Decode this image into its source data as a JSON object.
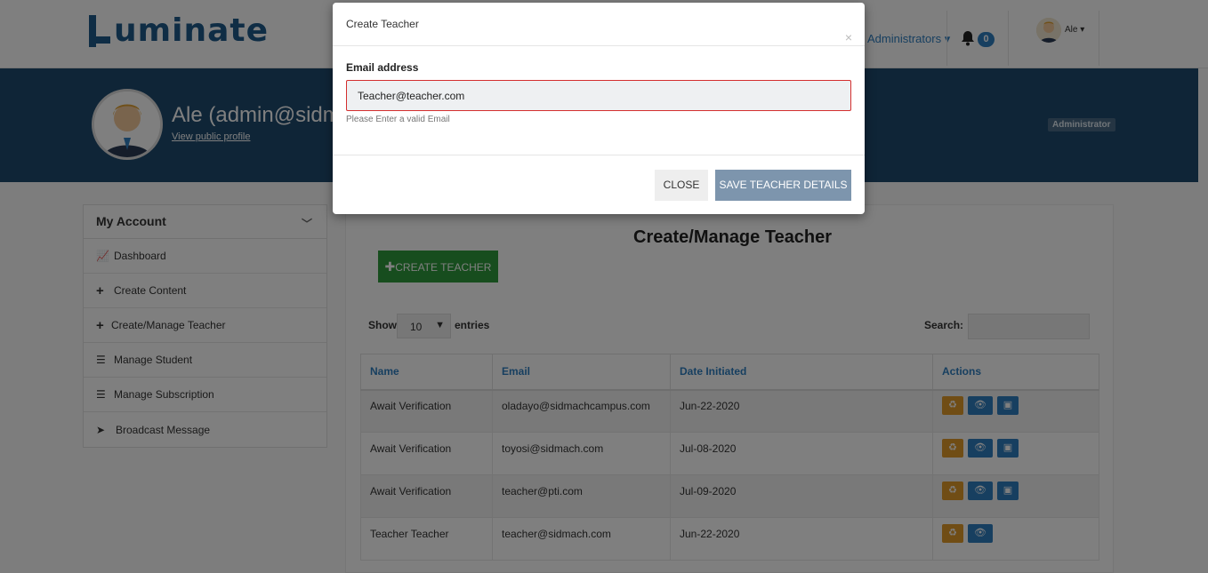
{
  "navbar": {
    "logo_text": "uminate",
    "admin_menu": "Administrators",
    "notification_count": "0",
    "user": "Ale"
  },
  "banner": {
    "name": "Ale (admin@sidmac",
    "profile_link": "View public profile",
    "role": "Administrator"
  },
  "sidebar": {
    "title": "My Account",
    "items": [
      {
        "label": "Dashboard",
        "icon": "chart-icon"
      },
      {
        "label": "Create Content",
        "icon": "plus-icon"
      },
      {
        "label": "Create/Manage Teacher",
        "icon": "plus-icon"
      },
      {
        "label": "Manage Student",
        "icon": "list-icon"
      },
      {
        "label": "Manage Subscription",
        "icon": "list-icon"
      },
      {
        "label": "Broadcast Message",
        "icon": "paper-plane-icon"
      }
    ]
  },
  "main": {
    "title": "Create/Manage Teacher",
    "create_button": "CREATE TEACHER",
    "show_label": "Show",
    "page_size": "10",
    "entries_label": "entries",
    "search_label": "Search:",
    "columns": [
      "Name",
      "Email",
      "Date Initiated",
      "Actions"
    ],
    "rows": [
      {
        "name": "Await Verification",
        "email": "oladayo@sidmachcampus.com",
        "date": "Jun-22-2020"
      },
      {
        "name": "Await Verification",
        "email": "toyosi@sidmach.com",
        "date": "Jul-08-2020"
      },
      {
        "name": "Await Verification",
        "email": "teacher@pti.com",
        "date": "Jul-09-2020"
      },
      {
        "name": "Teacher Teacher",
        "email": "teacher@sidmach.com",
        "date": "Jun-22-2020"
      }
    ]
  },
  "modal": {
    "title": "Create Teacher",
    "close_glyph": "×",
    "email_label": "Email address",
    "email_value": "Teacher@teacher.com",
    "help_text": "Please Enter a valid Email",
    "close_button": "CLOSE",
    "save_button": "SAVE TEACHER DETAILS"
  },
  "colors": {
    "brand": "#1f5a8a",
    "banner": "#1e4a6e",
    "link": "#2f7fc1",
    "success": "#2e9a3c",
    "warning": "#e09a2a",
    "error": "#d32f2f"
  }
}
